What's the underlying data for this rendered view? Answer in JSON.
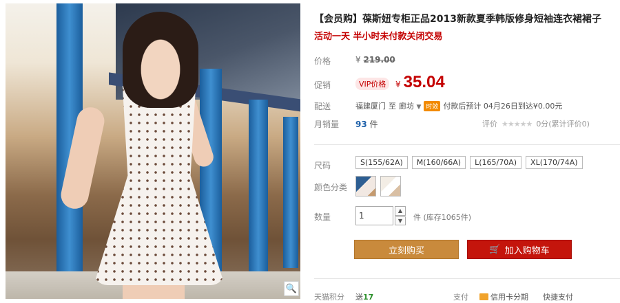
{
  "product": {
    "title": "【会员购】葆斯妞专柜正品2013新款夏季韩版修身短袖连衣裙裙子",
    "promo": "活动一天 半小时未付款关闭交易"
  },
  "price": {
    "label": "价格",
    "currency": "¥",
    "original": "219.00",
    "promo_label": "促销",
    "vip_badge": "VIP价格",
    "current": "35.04"
  },
  "shipping": {
    "label": "配送",
    "from": "福建厦门",
    "to_word": "至",
    "destination": "廊坊",
    "timely_badge": "时效",
    "estimate": "付款后预计 04月26日到达¥0.00元"
  },
  "sales": {
    "label": "月销量",
    "count": "93",
    "unit": "件",
    "rating_label": "评价",
    "rating_stars": "★★★★★",
    "rating_text": "0分(累计评价0)"
  },
  "size": {
    "label": "尺码",
    "options": [
      "S(155/62A)",
      "M(160/66A)",
      "L(165/70A)",
      "XL(170/74A)"
    ]
  },
  "color": {
    "label": "颜色分类"
  },
  "quantity": {
    "label": "数量",
    "value": "1",
    "up": "▲",
    "down": "▼",
    "stock": "件 (库存1065件)"
  },
  "actions": {
    "buy_now": "立刻购买",
    "add_to_cart": "加入购物车"
  },
  "footer": {
    "points_label": "天猫积分",
    "points_prefix": "送",
    "points_value": "17",
    "pay_label": "支付",
    "card_pay": "信用卡分期",
    "quick_pay": "快捷支付"
  },
  "icons": {
    "zoom": "🔍",
    "cart": "🛒",
    "chevron": "▼"
  },
  "colors": {
    "accent_red": "#c40000",
    "buy_button": "#c98a3c",
    "cart_button": "#c4150c"
  }
}
